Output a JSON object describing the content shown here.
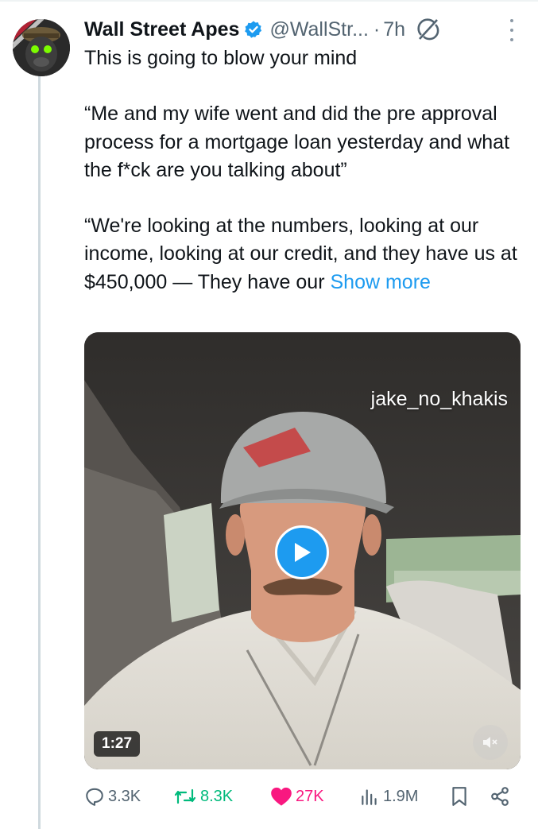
{
  "tweet": {
    "author_name": "Wall Street Apes",
    "author_handle": "@WallStr...",
    "separator": "·",
    "time": "7h",
    "text_lines": {
      "line1": "This is going to blow your mind",
      "para2": "“Me and my wife went and did the pre approval process for a mortgage loan yesterday and what the f*ck are you talking about”",
      "para3": "“We're looking at the numbers, looking at our income, looking at our credit, and they have us at $450,000 — They have our "
    },
    "show_more": "Show more"
  },
  "media": {
    "overlay_username": "jake_no_khakis",
    "duration": "1:27"
  },
  "actions": {
    "replies": "3.3K",
    "reposts": "8.3K",
    "likes": "27K",
    "views": "1.9M"
  },
  "colors": {
    "accent": "#1d9bf0",
    "repost": "#00ba7c",
    "like": "#f91880",
    "secondary_text": "#536471"
  },
  "icons": [
    "verified-badge-icon",
    "grok-icon",
    "more-options-icon",
    "play-icon",
    "volume-muted-icon",
    "reply-icon",
    "repost-icon",
    "like-icon",
    "views-icon",
    "bookmark-icon",
    "share-icon"
  ]
}
